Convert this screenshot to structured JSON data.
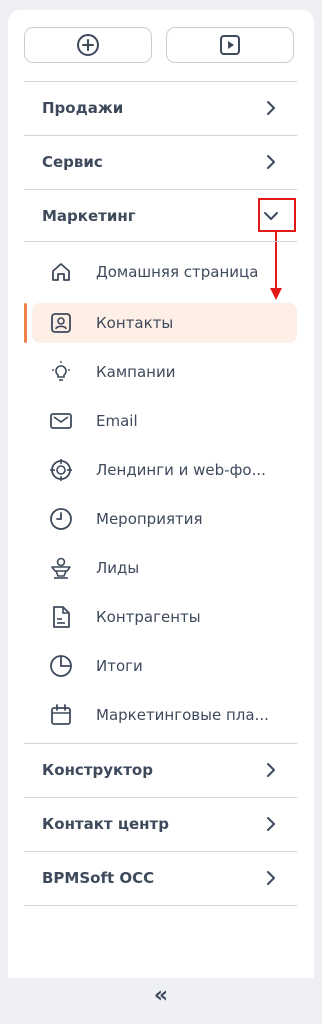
{
  "toolbar": {
    "add_icon": "plus-circle-icon",
    "play_icon": "play-square-icon"
  },
  "sections": [
    {
      "label": "Продажи",
      "icon": "chevron-right-icon"
    },
    {
      "label": "Сервис",
      "icon": "chevron-right-icon"
    },
    {
      "label": "Маркетинг",
      "icon": "chevron-down-icon",
      "expanded": true
    }
  ],
  "marketing_items": [
    {
      "label": "Домашняя страница",
      "icon": "home-icon"
    },
    {
      "label": "Контакты",
      "icon": "contact-icon",
      "active": true
    },
    {
      "label": "Кампании",
      "icon": "lightbulb-icon"
    },
    {
      "label": "Email",
      "icon": "envelope-icon"
    },
    {
      "label": "Лендинги и web-фо...",
      "icon": "target-icon"
    },
    {
      "label": "Мероприятия",
      "icon": "clock-icon"
    },
    {
      "label": "Лиды",
      "icon": "lead-icon"
    },
    {
      "label": "Контрагенты",
      "icon": "document-icon"
    },
    {
      "label": "Итоги",
      "icon": "pie-chart-icon"
    },
    {
      "label": "Маркетинговые пла...",
      "icon": "calendar-icon"
    }
  ],
  "bottom_sections": [
    {
      "label": "Конструктор",
      "icon": "chevron-right-icon"
    },
    {
      "label": "Контакт центр",
      "icon": "chevron-right-icon"
    },
    {
      "label": "BPMSoft OCC",
      "icon": "chevron-right-icon"
    }
  ],
  "footer": {
    "collapse_glyph": "«",
    "icon": "double-chevron-left-icon"
  },
  "colors": {
    "active_bg": "#fdeee6",
    "active_marker": "#f0834a",
    "annotation": "#e01a1a",
    "text": "#3e4a5c"
  }
}
